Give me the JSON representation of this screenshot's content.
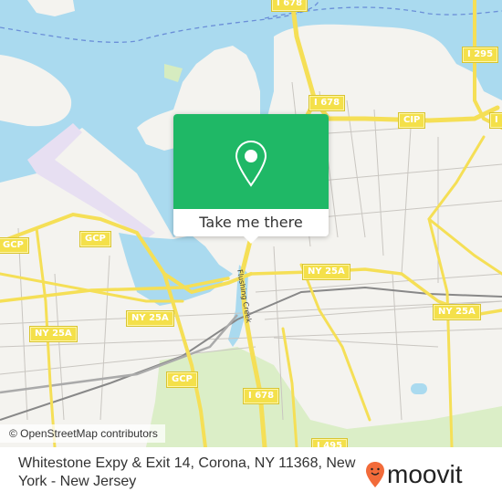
{
  "map": {
    "colors": {
      "water": "#aadaef",
      "land": "#f4f3ef",
      "park": "#d6ecc0",
      "highway": "#f5df56",
      "highway_casing": "#e8cd3a",
      "street": "#c9c6c1",
      "rail": "#888888",
      "airport": "#e7dff2",
      "ferry": "#6b8fd8"
    },
    "shields": [
      {
        "label": "I 678"
      },
      {
        "label": "I 678"
      },
      {
        "label": "I 295"
      },
      {
        "label": "CIP"
      },
      {
        "label": "I"
      },
      {
        "label": "GCP"
      },
      {
        "label": "GCP"
      },
      {
        "label": "NY 25A"
      },
      {
        "label": "NY 25A"
      },
      {
        "label": "NY 25A"
      },
      {
        "label": "NY 25A"
      },
      {
        "label": "GCP"
      },
      {
        "label": "I 678"
      },
      {
        "label": "I 495"
      }
    ],
    "street_label": "Flushing Creek"
  },
  "popup": {
    "button_label": "Take me there",
    "accent": "#1fb866"
  },
  "attribution": "© OpenStreetMap contributors",
  "footer": {
    "address": "Whitestone Expy & Exit 14, Corona, NY 11368, New York - New Jersey",
    "logo_text": "moovit",
    "logo_color": "#f26b3a"
  }
}
